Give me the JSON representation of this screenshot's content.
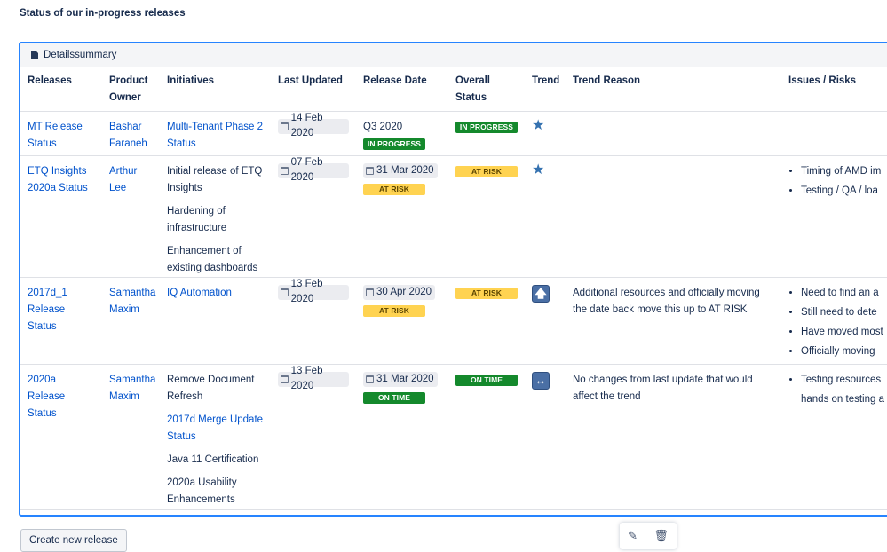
{
  "page_heading": "Status of our in-progress releases",
  "panel": {
    "title": "Detailssummary"
  },
  "columns": [
    "Releases",
    "Product Owner",
    "Initiatives",
    "Last Updated",
    "Release Date",
    "Overall Status",
    "Trend",
    "Trend Reason",
    "Issues / Risks"
  ],
  "rows": [
    {
      "release": "MT Release Status",
      "owner": "Bashar Faraneh",
      "initiatives": [
        {
          "text": "Multi-Tenant Phase 2 Status",
          "link": true
        }
      ],
      "last_updated": "14 Feb 2020",
      "release_date": {
        "text": "Q3 2020",
        "chip": false,
        "lozenge": "IN PROGRESS",
        "lozenge_color": "green"
      },
      "overall": {
        "text": "IN PROGRESS",
        "color": "green"
      },
      "trend": "star",
      "trend_reason": "",
      "issues": []
    },
    {
      "release": "ETQ Insights 2020a Status",
      "owner": "Arthur Lee",
      "initiatives": [
        {
          "text": "Initial release of ETQ Insights",
          "link": false
        },
        {
          "text": "Hardening of infrastructure",
          "link": false
        },
        {
          "text": "Enhancement of existing dashboards",
          "link": false
        }
      ],
      "last_updated": "07 Feb 2020",
      "release_date": {
        "text": "31 Mar 2020",
        "chip": true,
        "lozenge": "AT RISK",
        "lozenge_color": "yellow"
      },
      "overall": {
        "text": "AT RISK",
        "color": "yellow"
      },
      "trend": "star",
      "trend_reason": "",
      "issues": [
        "Timing of AMD im",
        "Testing / QA / loa"
      ]
    },
    {
      "release": "2017d_1 Release Status",
      "owner": "Samantha Maxim",
      "initiatives": [
        {
          "text": "IQ Automation",
          "link": true
        }
      ],
      "last_updated": "13 Feb 2020",
      "release_date": {
        "text": "30 Apr 2020",
        "chip": true,
        "lozenge": "AT RISK",
        "lozenge_color": "yellow"
      },
      "overall": {
        "text": "AT RISK",
        "color": "yellow"
      },
      "trend": "up-arrow",
      "trend_reason": "Additional resources and officially moving the date back move this up to AT RISK",
      "issues": [
        "Need to find an a",
        "Still need to dete",
        "Have moved most",
        "Officially moving"
      ]
    },
    {
      "release": "2020a Release Status",
      "owner": "Samantha Maxim",
      "initiatives": [
        {
          "text": "Remove Document Refresh",
          "link": false
        },
        {
          "text": "2017d Merge Update Status",
          "link": true
        },
        {
          "text": "Java 11 Certification",
          "link": false
        },
        {
          "text": "2020a Usability Enhancements",
          "link": false
        }
      ],
      "last_updated": "13 Feb 2020",
      "release_date": {
        "text": "31 Mar 2020",
        "chip": true,
        "lozenge": "ON TIME",
        "lozenge_color": "green"
      },
      "overall": {
        "text": "ON TIME",
        "color": "green"
      },
      "trend": "left-right-arrow",
      "trend_reason": "No changes from last update that would affect the trend",
      "issues": [
        "Testing resources",
        "hands on testing a"
      ]
    }
  ],
  "buttons": {
    "create_new_release": "Create new release"
  },
  "icons": {
    "edit": "pencil-icon",
    "delete": "trash-icon"
  }
}
